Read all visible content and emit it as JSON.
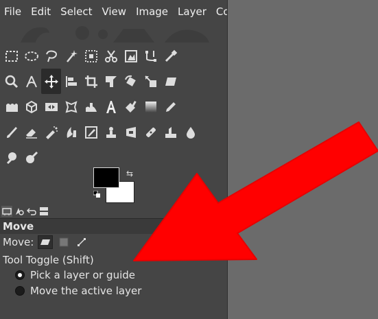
{
  "menubar": {
    "items": [
      "File",
      "Edit",
      "Select",
      "View",
      "Image",
      "Layer",
      "Colo"
    ]
  },
  "toolbox": {
    "tools": [
      "rect-select-icon",
      "ellipse-select-icon",
      "free-select-icon",
      "fuzzy-select-icon",
      "select-by-color-icon",
      "scissors-select-icon",
      "foreground-select-icon",
      "paths-icon",
      "color-picker-icon",
      "zoom-icon",
      "measure-icon",
      "move-icon",
      "align-icon",
      "crop-icon",
      "unified-transform-icon",
      "rotate-icon",
      "scale-icon",
      "shear-icon",
      "warp-transform-icon",
      "3d-transform-icon",
      "flip-icon",
      "cage-transform-icon",
      "bucket-fill-icon",
      "text-icon",
      "paint-select-icon",
      "gradient-icon",
      "pencil-icon",
      "paintbrush-icon",
      "eraser-icon",
      "airbrush-icon",
      "ink-icon",
      "mypaint-brush-icon",
      "clone-icon",
      "perspective-clone-icon",
      "heal-icon",
      "smudge-icon",
      "blur-icon",
      "dodge-burn-icon",
      "smudge2-icon"
    ],
    "active_tool_index": 11
  },
  "colors": {
    "foreground": "#000000",
    "background": "#ffffff"
  },
  "tool_options": {
    "title": "Move",
    "move_label": "Move:",
    "toggle_label": "Tool Toggle  (Shift)",
    "options": [
      "Pick a layer or guide",
      "Move the active layer"
    ],
    "selected_option_index": 0
  },
  "annotation": {
    "arrow_color": "#ff0000"
  }
}
